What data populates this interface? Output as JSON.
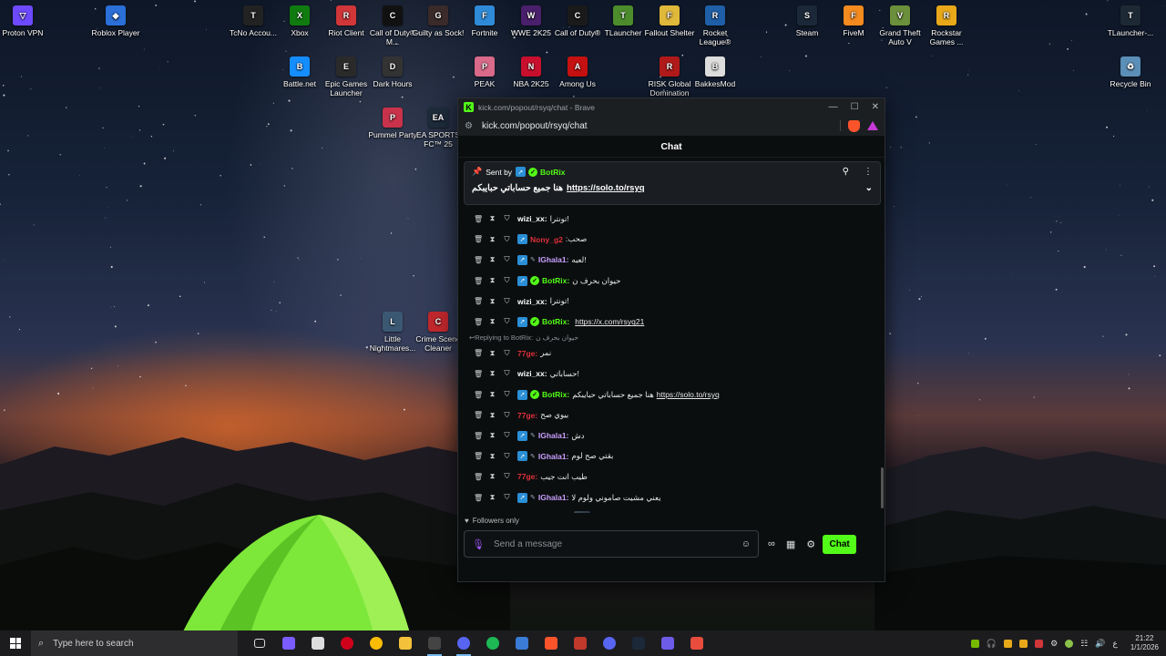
{
  "desktop_icons": [
    {
      "label": "Proton VPN",
      "color": "#6d4aff",
      "glyph": "▽"
    },
    {
      "label": "Roblox Player",
      "color": "#2b6fd8",
      "glyph": "◆"
    },
    {
      "label": "TcNo Accou...",
      "color": "#222",
      "glyph": "T"
    },
    {
      "label": "Xbox",
      "color": "#107c10",
      "glyph": "X"
    },
    {
      "label": "Riot Client",
      "color": "#d13639",
      "glyph": "R"
    },
    {
      "label": "Call of Duty® M...",
      "color": "#111",
      "glyph": "C"
    },
    {
      "label": "Guilty as Sock!",
      "color": "#3a2a2a",
      "glyph": "G"
    },
    {
      "label": "Fortnite",
      "color": "#2f8bd8",
      "glyph": "F"
    },
    {
      "label": "WWE 2K25",
      "color": "#4a1f6b",
      "glyph": "W"
    },
    {
      "label": "Call of Duty®",
      "color": "#1a1a1a",
      "glyph": "C"
    },
    {
      "label": "TLauncher",
      "color": "#4c8c2c",
      "glyph": "T"
    },
    {
      "label": "Fallout Shelter",
      "color": "#e0b83a",
      "glyph": "F"
    },
    {
      "label": "Rocket League®",
      "color": "#1f5fa8",
      "glyph": "R"
    },
    {
      "label": "Steam",
      "color": "#1b2838",
      "glyph": "S"
    },
    {
      "label": "FiveM",
      "color": "#f58a1f",
      "glyph": "F"
    },
    {
      "label": "Grand Theft Auto V",
      "color": "#6b8f3b",
      "glyph": "V"
    },
    {
      "label": "Rockstar Games ...",
      "color": "#e8a81a",
      "glyph": "R"
    },
    {
      "label": "TLauncher-...",
      "color": "#1d2a36",
      "glyph": "T"
    },
    {
      "label": "Battle.net",
      "color": "#148eff",
      "glyph": "B"
    },
    {
      "label": "Epic Games Launcher",
      "color": "#2a2a2a",
      "glyph": "E"
    },
    {
      "label": "Dark Hours",
      "color": "#333",
      "glyph": "D"
    },
    {
      "label": "PEAK",
      "color": "#d96a8a",
      "glyph": "P"
    },
    {
      "label": "NBA 2K25",
      "color": "#c8102e",
      "glyph": "N"
    },
    {
      "label": "Among Us",
      "color": "#c51111",
      "glyph": "A"
    },
    {
      "label": "RISK Global Domination",
      "color": "#b11a1a",
      "glyph": "R"
    },
    {
      "label": "BakkesMod",
      "color": "#ddd",
      "glyph": "B"
    },
    {
      "label": "Recycle Bin",
      "color": "#5b8fb8",
      "glyph": "♻"
    },
    {
      "label": "Pummel Party",
      "color": "#c8324a",
      "glyph": "P"
    },
    {
      "label": "EA SPORTS FC™ 25",
      "color": "#1e2b3a",
      "glyph": "EA"
    },
    {
      "label": "Little Nightmares...",
      "color": "#3b5872",
      "glyph": "L"
    },
    {
      "label": "Crime Scene Cleaner",
      "color": "#c0282d",
      "glyph": "C"
    }
  ],
  "browser": {
    "title": "kick.com/popout/rsyq/chat - Brave",
    "url": "kick.com/popout/rsyq/chat"
  },
  "chat": {
    "header": "Chat",
    "pinned": {
      "sent_by_label": "Sent by",
      "sender": "BotRix",
      "message_text": "هنا جميع حساباتي حبايبكم",
      "message_link": "https://solo.to/rsyq"
    },
    "messages": [
      {
        "user": "wizi_xx:",
        "color": "#ffffff",
        "sub": false,
        "verified": false,
        "pen": false,
        "text": "تونترا!",
        "link": ""
      },
      {
        "user": "Nony_g2",
        "color": "#e0303a",
        "sub": true,
        "verified": false,
        "pen": false,
        "text": ":صحب",
        "link": ""
      },
      {
        "user": "IGhala1:",
        "color": "#c9a0ff",
        "sub": true,
        "verified": false,
        "pen": true,
        "text": "لعبه!",
        "link": ""
      },
      {
        "user": "BotRix:",
        "color": "#53fc18",
        "sub": true,
        "verified": true,
        "pen": false,
        "text": "حيوان بحرف ن",
        "link": ""
      },
      {
        "user": "wizi_xx:",
        "color": "#ffffff",
        "sub": false,
        "verified": false,
        "pen": false,
        "text": "تونترا!",
        "link": ""
      },
      {
        "user": "BotRix:",
        "color": "#53fc18",
        "sub": true,
        "verified": true,
        "pen": false,
        "text": "",
        "link": "https://x.com/rsyq21"
      }
    ],
    "reply_label": "Replying to BotRix:",
    "reply_text": "حيوان بحرف ن",
    "messages2": [
      {
        "user": "77ge:",
        "color": "#e0303a",
        "sub": false,
        "verified": false,
        "pen": false,
        "text": "نمر",
        "link": ""
      },
      {
        "user": "wizi_xx:",
        "color": "#ffffff",
        "sub": false,
        "verified": false,
        "pen": false,
        "text": "حساباتي!",
        "link": ""
      },
      {
        "user": "BotRix:",
        "color": "#53fc18",
        "sub": true,
        "verified": true,
        "pen": false,
        "text": "هنا جميع حساباتي حبايبكم",
        "link": "https://solo.to/rsyq"
      },
      {
        "user": "77ge:",
        "color": "#e0303a",
        "sub": false,
        "verified": false,
        "pen": false,
        "text": "بيوي صح",
        "link": ""
      },
      {
        "user": "IGhala1:",
        "color": "#c9a0ff",
        "sub": true,
        "verified": false,
        "pen": true,
        "text": "دش",
        "link": ""
      },
      {
        "user": "IGhala1:",
        "color": "#c9a0ff",
        "sub": true,
        "verified": false,
        "pen": true,
        "text": "بقتي صح لوم",
        "link": ""
      },
      {
        "user": "77ge:",
        "color": "#e0303a",
        "sub": false,
        "verified": false,
        "pen": false,
        "text": "طيب انت جيب",
        "link": ""
      },
      {
        "user": "IGhala1:",
        "color": "#c9a0ff",
        "sub": true,
        "verified": false,
        "pen": true,
        "text": "يعني مشيت صاموني ولوم لا",
        "link": ""
      },
      {
        "user": "IGhala1:",
        "color": "#c9a0ff",
        "sub": true,
        "verified": false,
        "pen": true,
        "text": "",
        "link": "",
        "image": true
      }
    ],
    "followers_only": "Followers only",
    "input_placeholder": "Send a message",
    "send_button": "Chat"
  },
  "taskbar": {
    "search_placeholder": "Type here to search",
    "time": "21:22",
    "date": "1/1/2026",
    "lang": "ع"
  }
}
